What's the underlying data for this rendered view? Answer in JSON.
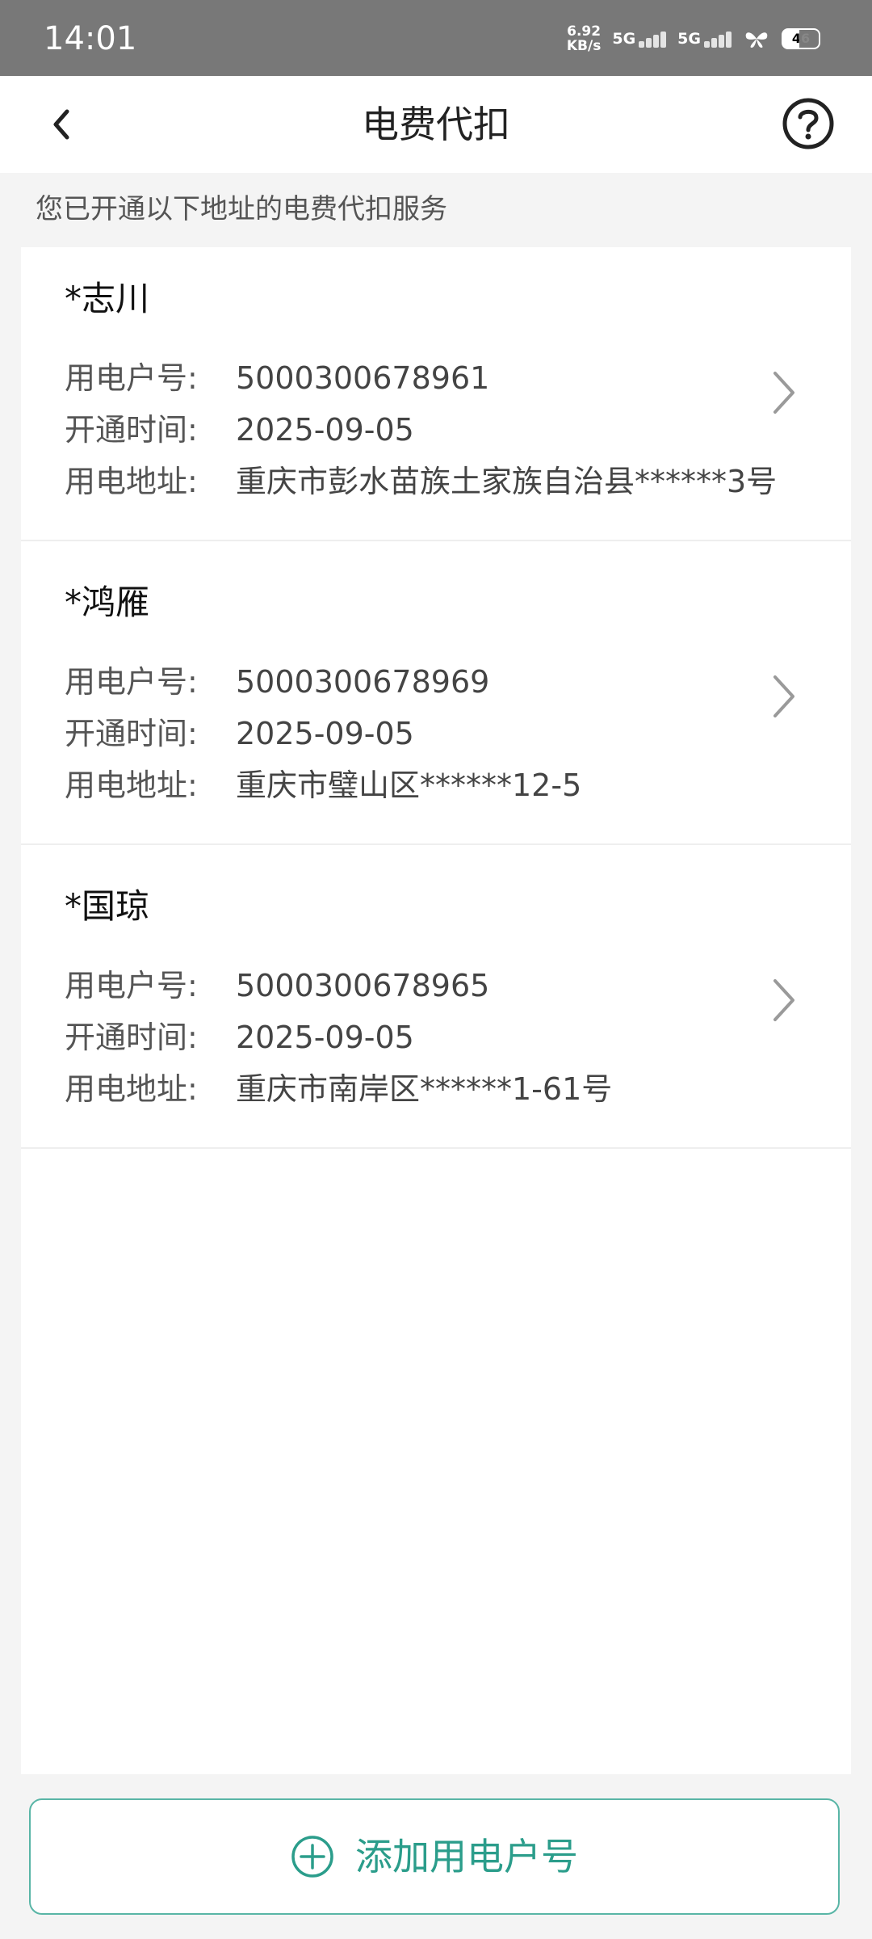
{
  "status_bar": {
    "time": "14:01",
    "net_speed_value": "6.92",
    "net_speed_unit": "KB/s",
    "sim1_label": "5G",
    "sim2_label": "5G",
    "battery_level": "46"
  },
  "header": {
    "title": "电费代扣",
    "back_icon": "chevron-left-icon",
    "help_icon": "question-circle-icon"
  },
  "subtitle": "您已开通以下地址的电费代扣服务",
  "labels": {
    "account": "用电户号:",
    "opened": "开通时间:",
    "address": "用电地址:"
  },
  "accounts": [
    {
      "name": "*志川",
      "account_no": "5000300678961",
      "opened_date": "2025-09-05",
      "address": "重庆市彭水苗族土家族自治县******3号"
    },
    {
      "name": "*鸿雁",
      "account_no": "5000300678969",
      "opened_date": "2025-09-05",
      "address": "重庆市璧山区******12-5"
    },
    {
      "name": "*国琼",
      "account_no": "5000300678965",
      "opened_date": "2025-09-05",
      "address": "重庆市南岸区******1-61号"
    }
  ],
  "add_button": {
    "label": "添加用电户号",
    "icon": "plus-circle-icon"
  },
  "colors": {
    "accent": "#2b9d8b",
    "status_bar_bg": "#787878",
    "page_bg": "#f4f4f4"
  }
}
